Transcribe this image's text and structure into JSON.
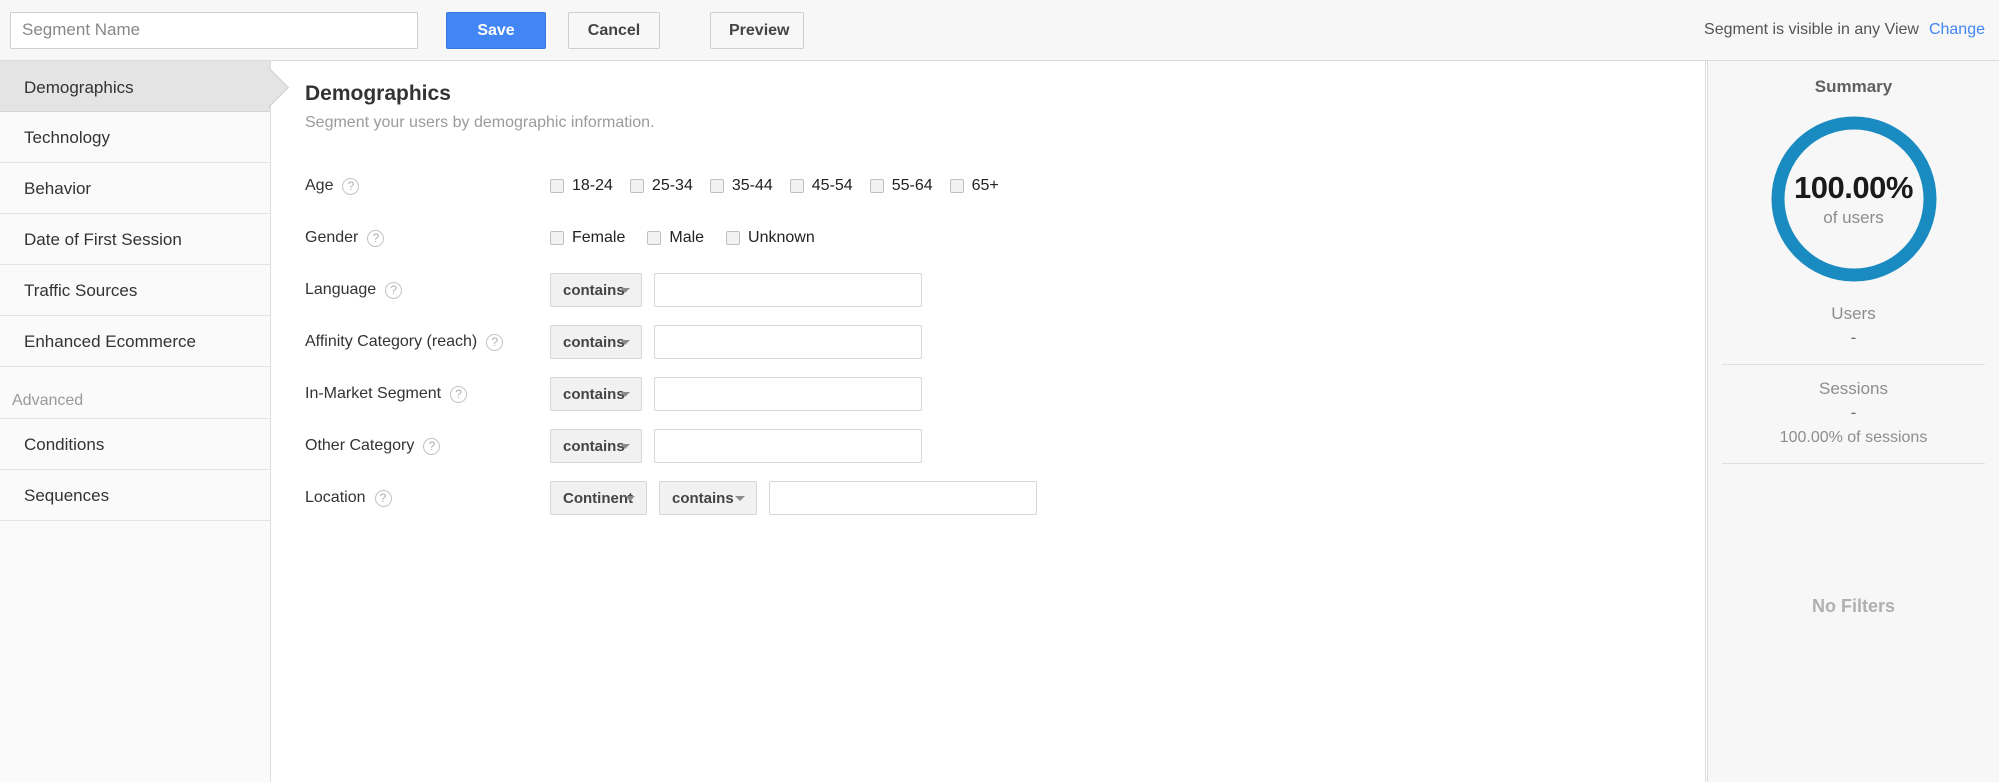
{
  "toolbar": {
    "segment_name_placeholder": "Segment Name",
    "segment_name_value": "",
    "save_label": "Save",
    "cancel_label": "Cancel",
    "preview_label": "Preview",
    "visibility_text": "Segment is visible in any View",
    "change_label": "Change",
    "accent_color": "#4285f4"
  },
  "sidebar": {
    "items": [
      {
        "label": "Demographics",
        "active": true
      },
      {
        "label": "Technology",
        "active": false
      },
      {
        "label": "Behavior",
        "active": false
      },
      {
        "label": "Date of First Session",
        "active": false
      },
      {
        "label": "Traffic Sources",
        "active": false
      },
      {
        "label": "Enhanced Ecommerce",
        "active": false
      }
    ],
    "advanced_label": "Advanced",
    "advanced_items": [
      {
        "label": "Conditions",
        "active": false
      },
      {
        "label": "Sequences",
        "active": false
      }
    ]
  },
  "main": {
    "title": "Demographics",
    "subtitle": "Segment your users by demographic information.",
    "help_glyph": "?",
    "age": {
      "label": "Age",
      "options": [
        {
          "label": "18-24",
          "checked": false
        },
        {
          "label": "25-34",
          "checked": false
        },
        {
          "label": "35-44",
          "checked": false
        },
        {
          "label": "45-54",
          "checked": false
        },
        {
          "label": "55-64",
          "checked": false
        },
        {
          "label": "65+",
          "checked": false
        }
      ]
    },
    "gender": {
      "label": "Gender",
      "options": [
        {
          "label": "Female",
          "checked": false
        },
        {
          "label": "Male",
          "checked": false
        },
        {
          "label": "Unknown",
          "checked": false
        }
      ]
    },
    "filter_rows": [
      {
        "label": "Language",
        "operator": "contains",
        "value": ""
      },
      {
        "label": "Affinity Category (reach)",
        "operator": "contains",
        "value": ""
      },
      {
        "label": "In-Market Segment",
        "operator": "contains",
        "value": ""
      },
      {
        "label": "Other Category",
        "operator": "contains",
        "value": ""
      }
    ],
    "location": {
      "label": "Location",
      "dimension": "Continent",
      "operator": "contains",
      "value": ""
    }
  },
  "summary": {
    "title": "Summary",
    "donut": {
      "percent_label": "100.00%",
      "percent_value": 100,
      "sub_label": "of users",
      "color": "#1a8bc0",
      "track_color": "#1a8bc0"
    },
    "users": {
      "name": "Users",
      "value": "-"
    },
    "sessions": {
      "name": "Sessions",
      "value": "-",
      "extra": "100.00% of sessions"
    },
    "no_filters_label": "No Filters"
  }
}
